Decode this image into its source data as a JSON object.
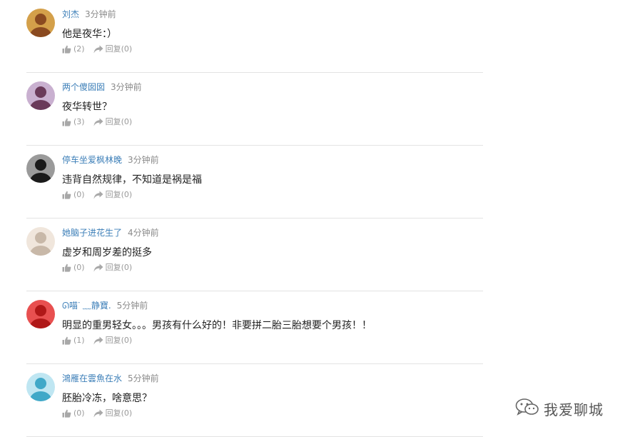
{
  "comments": [
    {
      "username": "刘杰",
      "time": "3分钟前",
      "text": "他是夜华：）",
      "likes": "(2)",
      "reply_label": "回复",
      "reply_count": "(0)",
      "avatar_colors": [
        "#8a4a20",
        "#d4a04a"
      ]
    },
    {
      "username": "两个傻囡囡",
      "time": "3分钟前",
      "text": "夜华转世？",
      "likes": "(3)",
      "reply_label": "回复",
      "reply_count": "(0)",
      "avatar_colors": [
        "#6a3a5a",
        "#c9b0d0"
      ]
    },
    {
      "username": "停车坐爱枫林晚",
      "time": "3分钟前",
      "text": "违背自然规律，不知道是祸是福",
      "likes": "(0)",
      "reply_label": "回复",
      "reply_count": "(0)",
      "avatar_colors": [
        "#1a1a1a",
        "#9a9a9a"
      ]
    },
    {
      "username": "她脑子进花生了",
      "time": "4分钟前",
      "text": "虚岁和周岁差的挺多",
      "likes": "(0)",
      "reply_label": "回复",
      "reply_count": "(0)",
      "avatar_colors": [
        "#c8b8a8",
        "#f0e6dc"
      ]
    },
    {
      "username": "ᘏ喵ᐝ ﹏静寶.",
      "time": "5分钟前",
      "text": "明显的重男轻女。。。男孩有什么好的！非要拼二胎三胎想要个男孩！！",
      "likes": "(1)",
      "reply_label": "回复",
      "reply_count": "(0)",
      "avatar_colors": [
        "#b01818",
        "#e85050"
      ]
    },
    {
      "username": "鴻雁在雲魚在水",
      "time": "5分钟前",
      "text": "胚胎冷冻，啥意思？",
      "likes": "(0)",
      "reply_label": "回复",
      "reply_count": "(0)",
      "avatar_colors": [
        "#40a8c8",
        "#bfe6f2"
      ]
    }
  ],
  "watermark": {
    "text": "我爱聊城",
    "icon": "wechat-icon"
  }
}
